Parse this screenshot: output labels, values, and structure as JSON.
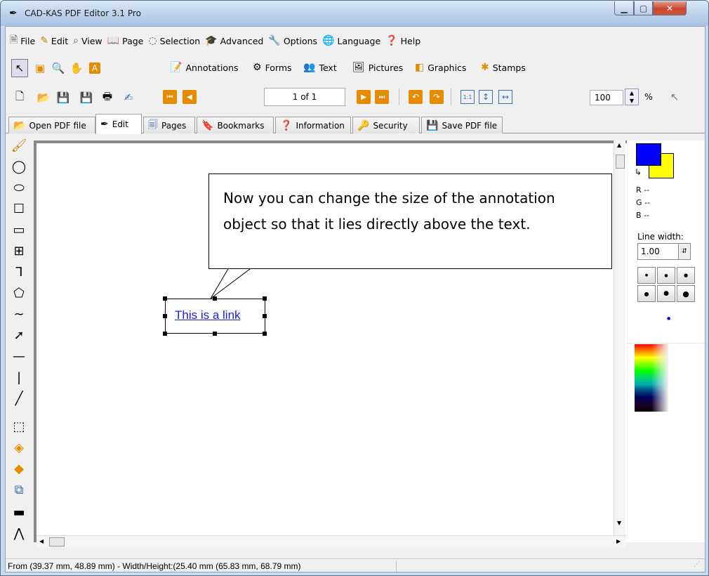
{
  "window": {
    "title": "CAD-KAS PDF Editor 3.1 Pro"
  },
  "menu": [
    {
      "label": "File",
      "icon": "file-icon"
    },
    {
      "label": "Edit",
      "icon": "edit-icon"
    },
    {
      "label": "View",
      "icon": "view-icon"
    },
    {
      "label": "Page",
      "icon": "page-icon"
    },
    {
      "label": "Selection",
      "icon": "selection-icon"
    },
    {
      "label": "Advanced",
      "icon": "advanced-icon"
    },
    {
      "label": "Options",
      "icon": "options-icon"
    },
    {
      "label": "Language",
      "icon": "language-icon"
    },
    {
      "label": "Help",
      "icon": "help-icon"
    }
  ],
  "toolbar1": {
    "annotations": "Annotations",
    "forms": "Forms",
    "text": "Text",
    "pictures": "Pictures",
    "graphics": "Graphics",
    "stamps": "Stamps"
  },
  "toolbar2": {
    "page_indicator": "1 of 1",
    "zoom": "100",
    "zoom_unit": "%"
  },
  "tabs": [
    {
      "label": "Open PDF file"
    },
    {
      "label": "Edit"
    },
    {
      "label": "Pages"
    },
    {
      "label": "Bookmarks"
    },
    {
      "label": "Information"
    },
    {
      "label": "Security"
    },
    {
      "label": "Save PDF file"
    }
  ],
  "canvas": {
    "callout_text": "Now you can change the size of the annotation object so that it lies directly above the text.",
    "link_text": "This is a link"
  },
  "properties": {
    "r": "R --",
    "g": "G --",
    "b": "B --",
    "line_width_label": "Line width:",
    "line_width_value": "1.00",
    "fg_color": "#0000ff",
    "bg_color": "#ffff00"
  },
  "status": {
    "text": "From (39.37 mm, 48.89 mm) - Width/Height:(25.40 mm (65.83 mm, 68.79 mm)"
  }
}
